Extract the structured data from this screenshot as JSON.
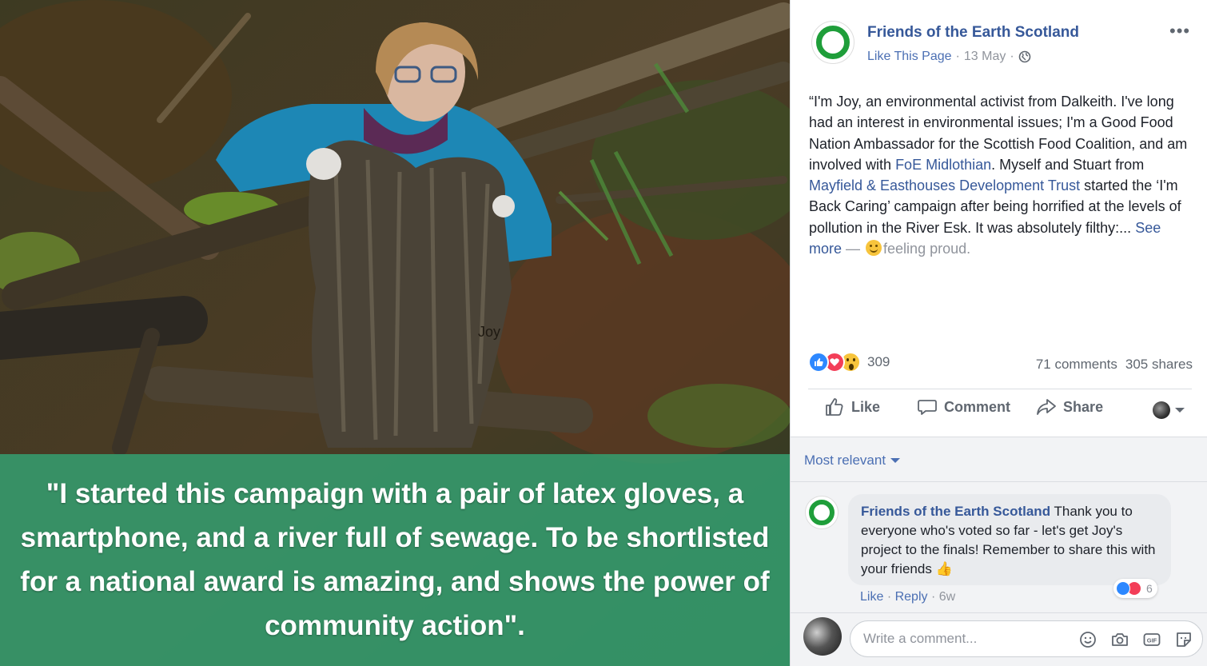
{
  "photo": {
    "caption": "Joy",
    "quote": "\"I started this campaign with a pair of latex gloves, a smartphone, and a river full of sewage. To be shortlisted for a national award is amazing, and shows the power of community action\"."
  },
  "post": {
    "page_name": "Friends of the Earth Scotland",
    "like_page": "Like This Page",
    "date": "13 May",
    "more_label": "•••",
    "body": {
      "t1": "“I'm Joy, an environmental activist from Dalkeith. I've long had an interest in environmental issues; I'm a Good Food Nation Ambassador for the Scottish Food Coalition, and am involved with ",
      "link1": "FoE Midlothian",
      "t2": ". Myself and Stuart from ",
      "link2": "Mayfield & Easthouses Development Trust",
      "t3": " started the ‘I'm Back Caring’ campaign after being horrified at the levels of pollution in the River Esk. It was absolutely filthy:... ",
      "see_more": "See more",
      "dash": " — ",
      "feeling": "feeling proud."
    },
    "reaction_count": "309",
    "comments_count": "71 comments",
    "shares_count": "305 shares",
    "actions": {
      "like": "Like",
      "comment": "Comment",
      "share": "Share"
    },
    "sort_label": "Most relevant",
    "comment": {
      "author": "Friends of the Earth Scotland",
      "text": " Thank you to everyone who's voted so far - let's get Joy's project to the finals! Remember to share this with your friends ",
      "reaction_count": "6",
      "like": "Like",
      "reply": "Reply",
      "age": "6w"
    },
    "write_placeholder": "Write a comment...",
    "colors": {
      "link": "#365899",
      "brand_green": "#1f9e3a",
      "quote_panel": "#349e70"
    }
  }
}
